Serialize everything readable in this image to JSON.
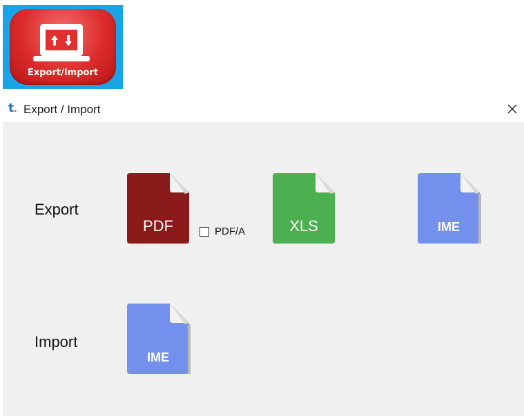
{
  "app_icon": {
    "label": "Export/Import",
    "icon": "laptop-transfer-icon"
  },
  "window": {
    "title": "Export / Import",
    "logo_text": "t",
    "logo_dot": ".",
    "close_icon": "close-icon"
  },
  "export": {
    "label": "Export",
    "pdf_label": "PDF",
    "pdfa_label": "PDF/A",
    "pdfa_checked": false,
    "xls_label": "XLS",
    "ime_label": "IME"
  },
  "import": {
    "label": "Import",
    "ime_label": "IME"
  },
  "colors": {
    "pdf": "#8b1a1a",
    "xls": "#4caf50",
    "ime": "#7391ec",
    "icon_bg": "#1aa4e8",
    "icon_red": "#dc2c2c"
  }
}
